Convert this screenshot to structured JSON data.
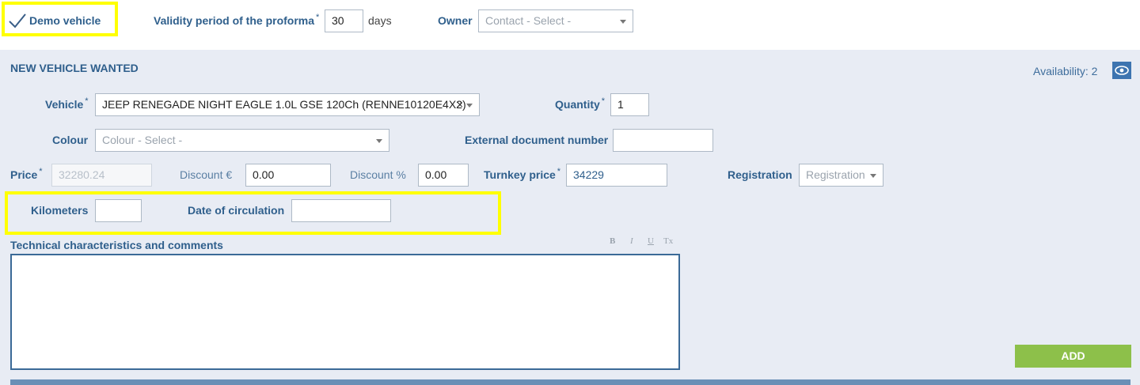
{
  "top": {
    "demo_vehicle_label": "Demo vehicle",
    "validity_label": "Validity period of the proforma",
    "validity_value": "30",
    "validity_unit": "days",
    "owner_label": "Owner",
    "owner_placeholder": "Contact - Select -"
  },
  "panel": {
    "title": "NEW VEHICLE WANTED",
    "availability": "Availability: 2",
    "vehicle_label": "Vehicle",
    "vehicle_value": "JEEP RENEGADE NIGHT EAGLE 1.0L GSE 120Ch (RENNE10120E4X2)",
    "quantity_label": "Quantity",
    "quantity_value": "1",
    "colour_label": "Colour",
    "colour_placeholder": "Colour - Select -",
    "ext_doc_label": "External document number",
    "ext_doc_value": "",
    "price_label": "Price",
    "price_value": "32280.24",
    "discount_eur_label": "Discount €",
    "discount_eur_value": "0.00",
    "discount_pct_label": "Discount %",
    "discount_pct_value": "0.00",
    "turnkey_label": "Turnkey price",
    "turnkey_value": "34229",
    "registration_label": "Registration",
    "registration_placeholder": "Registration",
    "km_label": "Kilometers",
    "km_value": "",
    "date_label": "Date of circulation",
    "date_value": "",
    "tech_label": "Technical characteristics and comments",
    "editor": {
      "bold": "B",
      "italic": "I",
      "underline": "U",
      "clear": "Tx"
    },
    "tech_value": "",
    "add_button": "ADD"
  },
  "colors": {
    "panel_bg": "#e8ecf4",
    "label_blue": "#2f5f8c",
    "add_green": "#8dc04a",
    "highlight_yellow": "#ffff00",
    "eye_blue": "#3d74b0"
  }
}
